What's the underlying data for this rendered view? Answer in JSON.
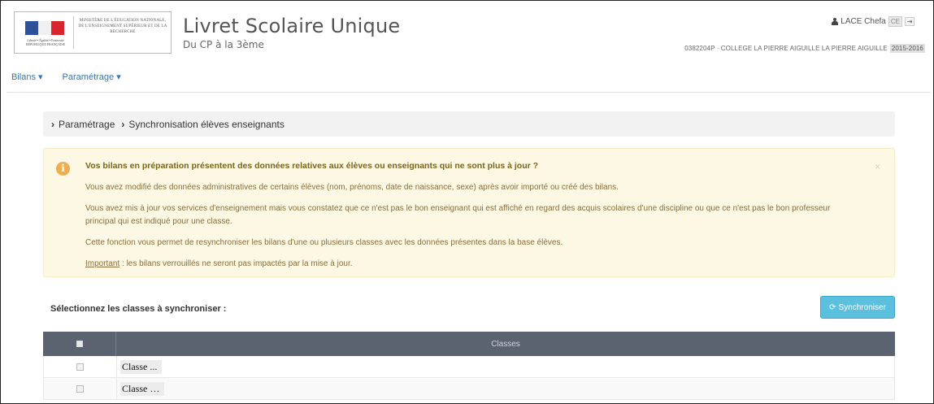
{
  "header": {
    "logo_text": "MINISTÈRE DE L'ÉDUCATION NATIONALE, DE L'ENSEIGNEMENT SUPÉRIEUR ET DE LA RECHERCHE",
    "logo_motto": "Liberté • Égalité • Fraternité RÉPUBLIQUE FRANÇAISE",
    "app_title": "Livret Scolaire Unique",
    "app_subtitle": "Du CP à la 3ème",
    "user_name": "LACE Chefa",
    "user_badge": "CE",
    "school": "0382204P · COLLEGE LA PIERRE AIGUILLE LA PIERRE AIGUILLE",
    "year": "2015-2016"
  },
  "nav": {
    "bilans": "Bilans ▾",
    "parametrage": "Paramétrage ▾"
  },
  "breadcrumb": {
    "items": [
      "Paramétrage",
      "Synchronisation élèves enseignants"
    ]
  },
  "alert": {
    "heading": "Vos bilans en préparation présentent des données relatives aux élèves ou enseignants qui ne sont plus à jour ?",
    "p1": "Vous avez modifié des données administratives de certains élèves (nom, prénoms, date de naissance, sexe) après avoir importé ou créé des bilans.",
    "p2": "Vous avez mis à jour vos services d'enseignement mais vous constatez que ce n'est pas le bon enseignant qui est affiché en regard des acquis scolaires d'une discipline ou que ce n'est pas le bon professeur principal qui est indiqué pour une classe.",
    "p3": "Cette fonction vous permet de resynchroniser les bilans d'une ou plusieurs classes avec les données présentes dans la base élèves.",
    "p4_link": "Important",
    "p4_rest": " : les bilans verrouillés ne seront pas impactés par la mise à jour.",
    "close": "×"
  },
  "select": {
    "title": "Sélectionnez les classes à synchroniser :",
    "button": "Synchroniser"
  },
  "table": {
    "header": "Classes",
    "rows": [
      "Classe ...",
      "Classe …"
    ]
  },
  "colors": {
    "nav_link": "#3a75b0",
    "alert_bg": "#fcf8e3",
    "button": "#5bc0de",
    "table_header": "#5b6371"
  }
}
